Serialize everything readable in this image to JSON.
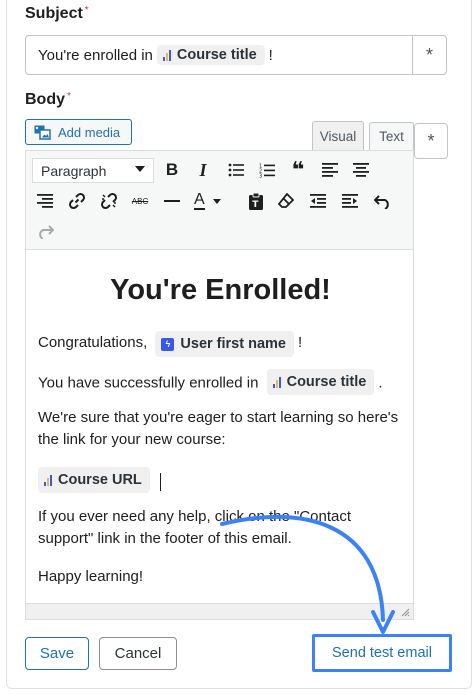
{
  "subject": {
    "label": "Subject",
    "required_mark": "*",
    "text_before": "You're enrolled in",
    "token_label": "Course title",
    "text_after": "!",
    "star_label": "*"
  },
  "body": {
    "label": "Body",
    "required_mark": "*",
    "add_media_label": "Add media",
    "tab_visual": "Visual",
    "tab_text": "Text",
    "star_label": "*"
  },
  "toolbar": {
    "format_value": "Paragraph",
    "icons": [
      "bold-icon",
      "italic-icon",
      "bullet-list-icon",
      "numbered-list-icon",
      "blockquote-icon",
      "align-left-icon",
      "align-center-icon",
      "align-right-icon",
      "link-icon",
      "unlink-icon",
      "strikethrough-icon",
      "horizontal-rule-icon",
      "text-color-icon",
      "paste-text-icon",
      "clear-format-icon",
      "outdent-icon",
      "indent-icon",
      "undo-icon",
      "redo-icon"
    ],
    "bold": "B",
    "italic": "I",
    "quote": "❝",
    "strike": "ABC",
    "text_color": "A"
  },
  "content": {
    "heading": "You're Enrolled!",
    "congrats_before": "Congratulations,",
    "user_token": "User first name",
    "congrats_after": "!",
    "enrolled_before": "You have successfully enrolled in",
    "course_token": "Course title",
    "enrolled_after": ".",
    "eager_text": "We're sure that you're eager to start learning so here's the link for your new course:",
    "url_token": "Course URL",
    "help_text": "If you ever need any help, click on the \"Contact support\" link in the footer of this email.",
    "closing": "Happy learning!"
  },
  "actions": {
    "save_label": "Save",
    "cancel_label": "Cancel",
    "send_test_label": "Send test email"
  },
  "colors": {
    "primary": "#2271b1",
    "highlight_arrow": "#3b82f6",
    "required": "#d63638"
  }
}
